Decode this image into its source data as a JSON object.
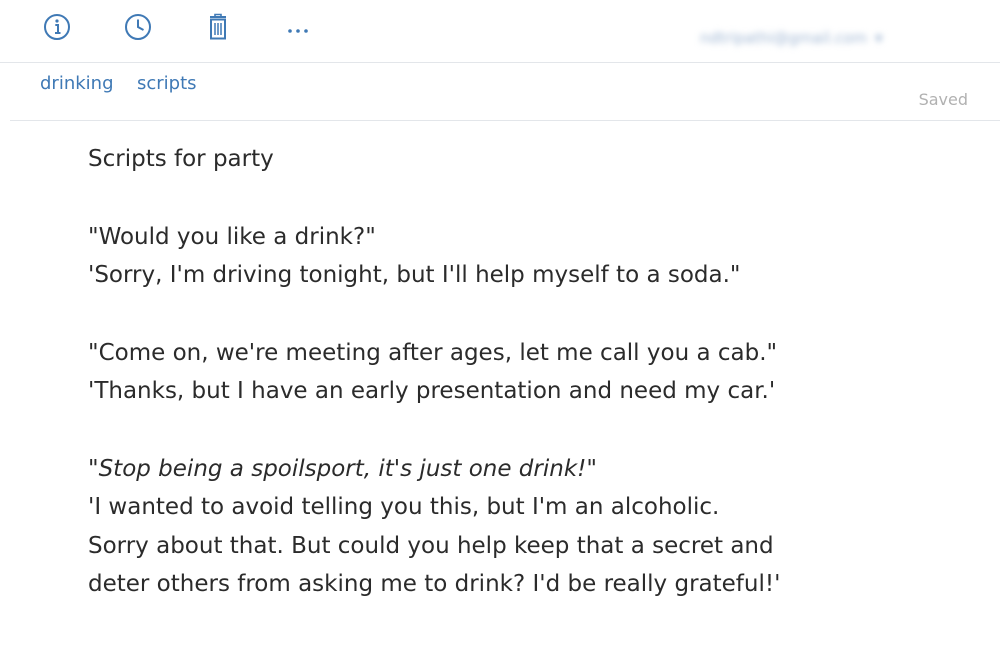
{
  "toolbar": {
    "icons": [
      "info-icon",
      "clock-icon",
      "trash-icon",
      "more-icon"
    ],
    "account_label": "ndtripathi@gmail.com",
    "accent_color": "#3f79b5"
  },
  "tags": [
    "drinking",
    "scripts"
  ],
  "status": "Saved",
  "note": {
    "title": "Scripts for party",
    "p1_l1": "\"Would you like a drink?\"",
    "p1_l2": "'Sorry, I'm driving tonight, but I'll help myself to a soda.\"",
    "p2_l1": "\"Come on, we're meeting after ages, let me call you a cab.\"",
    "p2_l2": "'Thanks, but I have an early presentation and need my car.'",
    "p3_l1": "\"Stop being a spoilsport, it's just one drink!\"",
    "p3_l2": "'I wanted to avoid telling you this, but I'm an alcoholic.",
    "p3_l3": "Sorry about that. But could you help keep that a secret and",
    "p3_l4": "deter others from asking me to drink? I'd be really grateful!'"
  }
}
